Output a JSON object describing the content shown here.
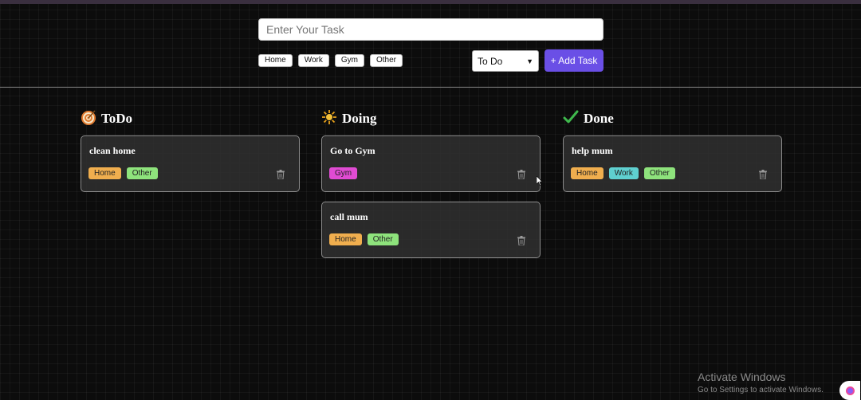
{
  "form": {
    "placeholder": "Enter Your Task",
    "tags": [
      "Home",
      "Work",
      "Gym",
      "Other"
    ],
    "status_selected": "To Do",
    "add_label": "+ Add Task"
  },
  "tag_colors": {
    "Home": "#f0ae4e",
    "Work": "#5fd0d0",
    "Gym": "#e04bd3",
    "Other": "#8ee37c"
  },
  "accent": "#6a4fe6",
  "columns": [
    {
      "title": "ToDo",
      "icon": "target-icon",
      "cards": [
        {
          "title": "clean home",
          "tags": [
            "Home",
            "Other"
          ]
        }
      ]
    },
    {
      "title": "Doing",
      "icon": "sparkle-icon",
      "cards": [
        {
          "title": "Go to Gym",
          "tags": [
            "Gym"
          ]
        },
        {
          "title": "call mum",
          "tags": [
            "Home",
            "Other"
          ]
        }
      ]
    },
    {
      "title": "Done",
      "icon": "checkmark-icon",
      "cards": [
        {
          "title": "help mum",
          "tags": [
            "Home",
            "Work",
            "Other"
          ]
        }
      ]
    }
  ],
  "watermark": {
    "title": "Activate Windows",
    "subtitle": "Go to Settings to activate Windows."
  }
}
